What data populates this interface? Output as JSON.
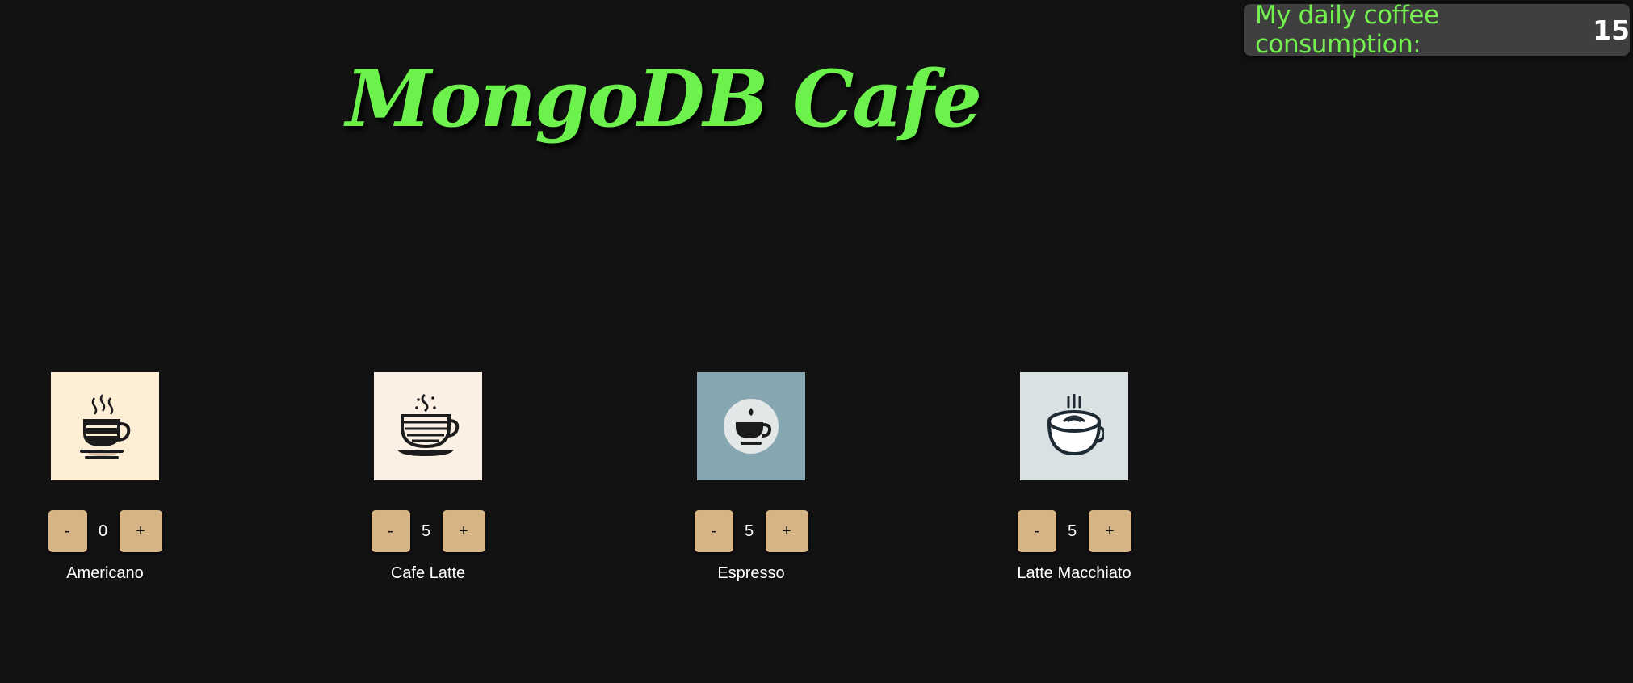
{
  "header": {
    "consumption_label": "My daily coffee consumption:",
    "consumption_total": "15"
  },
  "title": "MongoDB Cafe",
  "colors": {
    "accent_green": "#6df24d",
    "button": "#d6b486",
    "background": "#121212",
    "badge_background": "#3f3f3f"
  },
  "drinks": [
    {
      "name": "Americano",
      "count": "0",
      "minus_label": "-",
      "plus_label": "+",
      "icon": "americano-cup-icon"
    },
    {
      "name": "Cafe Latte",
      "count": "5",
      "minus_label": "-",
      "plus_label": "+",
      "icon": "latte-cup-icon"
    },
    {
      "name": "Espresso",
      "count": "5",
      "minus_label": "-",
      "plus_label": "+",
      "icon": "espresso-cup-icon"
    },
    {
      "name": "Latte Macchiato",
      "count": "5",
      "minus_label": "-",
      "plus_label": "+",
      "icon": "macchiato-cup-icon"
    }
  ]
}
